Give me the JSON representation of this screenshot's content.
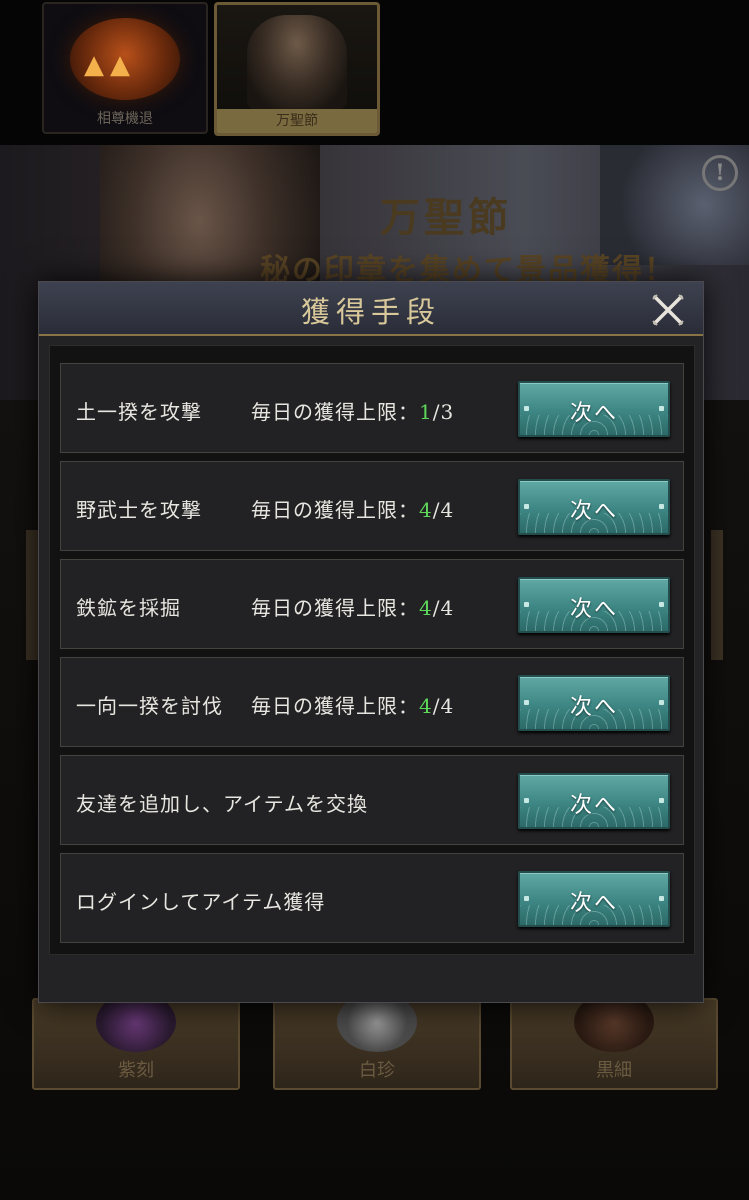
{
  "background": {
    "tabs": [
      {
        "label": "相尊機退"
      },
      {
        "label": "万聖節"
      }
    ],
    "banner": {
      "title": "万聖節",
      "subtitle": "秘の印章を集めて景品獲得！",
      "info_symbol": "!"
    },
    "bottom_cards": [
      {
        "label": "紫刻"
      },
      {
        "label": "白珍"
      },
      {
        "label": "黒細"
      }
    ]
  },
  "dialog": {
    "title": "獲得手段",
    "close_icon": "close-x-icon",
    "rows": [
      {
        "name": "土一揆を攻撃",
        "limit_label": "毎日の獲得上限：",
        "current": "1",
        "max": "/3",
        "button": "次へ"
      },
      {
        "name": "野武士を攻撃",
        "limit_label": "毎日の獲得上限：",
        "current": "4",
        "max": "/4",
        "button": "次へ"
      },
      {
        "name": "鉄鉱を採掘",
        "limit_label": "毎日の獲得上限：",
        "current": "4",
        "max": "/4",
        "button": "次へ"
      },
      {
        "name": "一向一揆を討伐",
        "limit_label": "毎日の獲得上限：",
        "current": "4",
        "max": "/4",
        "button": "次へ"
      },
      {
        "name": "友達を追加し、アイテムを交換",
        "button": "次へ"
      },
      {
        "name": "ログインしてアイテム獲得",
        "button": "次へ"
      }
    ]
  },
  "colors": {
    "accent_teal": "#3d8683",
    "gold_text": "#d8c89a",
    "count_green": "#5ed85a"
  }
}
